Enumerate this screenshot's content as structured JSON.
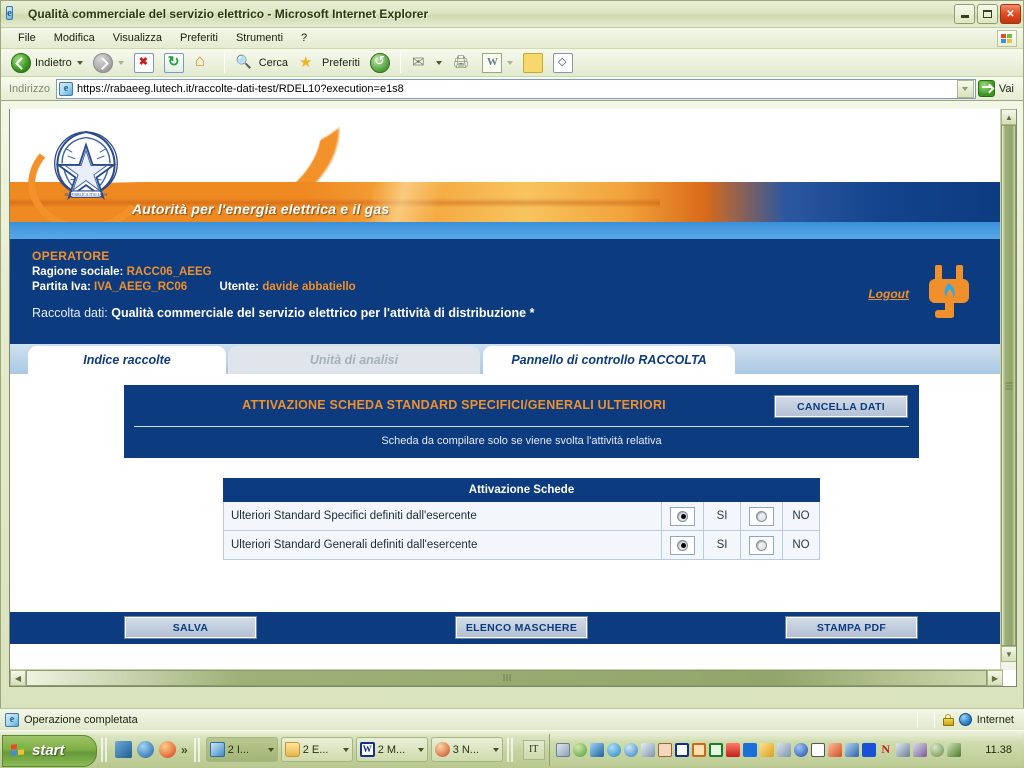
{
  "window": {
    "title": "Qualità commerciale del servizio elettrico - Microsoft Internet Explorer",
    "minimize_label": "Minimizza",
    "maximize_label": "Ripristina",
    "close_label": "Chiudi"
  },
  "menu": {
    "items": [
      "File",
      "Modifica",
      "Visualizza",
      "Preferiti",
      "Strumenti",
      "?"
    ]
  },
  "toolbar": {
    "back_label": "Indietro",
    "search_label": "Cerca",
    "favorites_label": "Preferiti",
    "icons": [
      "back-icon",
      "forward-icon",
      "stop-icon",
      "refresh-icon",
      "home-icon",
      "search-icon",
      "star-icon",
      "history-icon",
      "mail-icon",
      "print-icon",
      "word-icon",
      "note-icon",
      "messenger-icon"
    ]
  },
  "address": {
    "label": "Indirizzo",
    "url": "https://rabaeeg.lutech.it/raccolte-dati-test/RDEL10?execution=e1s8",
    "go_label": "Vai"
  },
  "banner": {
    "authority": "Autorità per l'energia elettrica e il gas",
    "emblem_name": "republic-of-italy-emblem",
    "plug_name": "electric-plug-icon"
  },
  "operator": {
    "heading": "OPERATORE",
    "ragione_label": "Ragione sociale:",
    "ragione_value": "RACC06_AEEG",
    "partita_label": "Partita Iva:",
    "partita_value": "IVA_AEEG_RC06",
    "utente_label": "Utente:",
    "utente_value": "davide abbatiello",
    "raccolta_label": "Raccolta dati:",
    "raccolta_value": "Qualità commerciale del servizio elettrico per l'attività di distribuzione *",
    "logout_label": "Logout"
  },
  "tabs": [
    {
      "label": "Indice raccolte",
      "state": "active"
    },
    {
      "label": "Unità di analisi",
      "state": "disabled"
    },
    {
      "label": "Pannello di controllo RACCOLTA",
      "state": "active"
    }
  ],
  "panel": {
    "title": "ATTIVAZIONE SCHEDA STANDARD SPECIFICI/GENERALI ULTERIORI",
    "clear_button": "CANCELLA DATI",
    "subtitle": "Scheda da compilare solo se viene svolta l'attività relativa"
  },
  "table": {
    "header": "Attivazione Schede",
    "rows": [
      {
        "description": "Ulteriori Standard Specifici definiti dall'esercente",
        "yes_label": "SI",
        "no_label": "NO",
        "selected": "SI"
      },
      {
        "description": "Ulteriori Standard Generali definiti dall'esercente",
        "yes_label": "SI",
        "no_label": "NO",
        "selected": "SI"
      }
    ]
  },
  "actions": {
    "save": "SALVA",
    "masks": "ELENCO MASCHERE",
    "print": "STAMPA PDF"
  },
  "statusbar": {
    "message": "Operazione completata",
    "zone": "Internet",
    "lock_icon": "lock-icon"
  },
  "taskbar": {
    "start_label": "start",
    "tasks": [
      {
        "label": "2 I...",
        "icon": "ie-icon",
        "active": true
      },
      {
        "label": "2 E...",
        "icon": "folder-icon",
        "active": false
      },
      {
        "label": "2 M...",
        "icon": "word-icon",
        "active": false
      },
      {
        "label": "3 N...",
        "icon": "paint-icon",
        "active": false
      }
    ],
    "language": "IT",
    "clock": "11.38",
    "overflow_label": "»"
  },
  "colors": {
    "brand_blue": "#0d3b80",
    "brand_orange": "#f0902b",
    "tab_strip": "#aac8e4",
    "table_row": "#f3f7fb",
    "xp_green": "#7fae45"
  }
}
